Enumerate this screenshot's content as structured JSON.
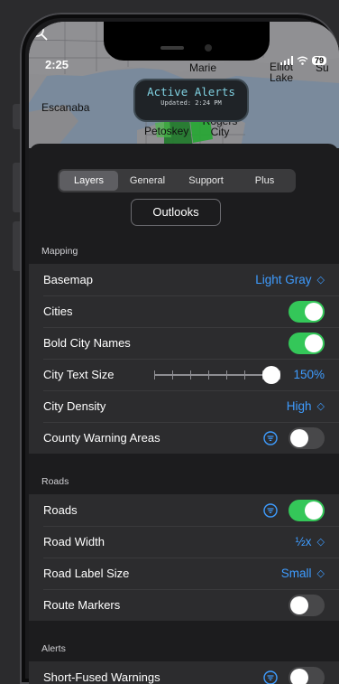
{
  "status": {
    "time": "2:25",
    "battery": "79"
  },
  "map": {
    "labels": {
      "escanaba": "Escanaba",
      "petoskey": "Petoskey",
      "rogers_city": "Rogers City",
      "marie": "Marie",
      "elliot_lake": "Elliot Lake",
      "su": "Su"
    },
    "alert_title": "Active Alerts",
    "alert_updated": "Updated: 2:24 PM"
  },
  "tabs": [
    {
      "label": "Layers",
      "active": true
    },
    {
      "label": "General",
      "active": false
    },
    {
      "label": "Support",
      "active": false
    },
    {
      "label": "Plus",
      "active": false
    }
  ],
  "outlooks_label": "Outlooks",
  "sections": {
    "mapping": {
      "header": "Mapping",
      "basemap": {
        "label": "Basemap",
        "value": "Light Gray"
      },
      "cities": {
        "label": "Cities",
        "on": true
      },
      "bold_city_names": {
        "label": "Bold City Names",
        "on": true
      },
      "city_text_size": {
        "label": "City Text Size",
        "value": "150%",
        "level": 1.0
      },
      "city_density": {
        "label": "City Density",
        "value": "High"
      },
      "county_warning_areas": {
        "label": "County Warning Areas",
        "on": false
      }
    },
    "roads": {
      "header": "Roads",
      "roads": {
        "label": "Roads",
        "on": true
      },
      "road_width": {
        "label": "Road Width",
        "value": "½x"
      },
      "road_label_size": {
        "label": "Road Label Size",
        "value": "Small"
      },
      "route_markers": {
        "label": "Route Markers",
        "on": false
      }
    },
    "alerts": {
      "header": "Alerts",
      "short_fused_warnings": {
        "label": "Short-Fused Warnings",
        "on": false
      }
    }
  },
  "colors": {
    "accent": "#3e9cff",
    "toggle_on": "#34c759",
    "toggle_off": "#48484a"
  }
}
